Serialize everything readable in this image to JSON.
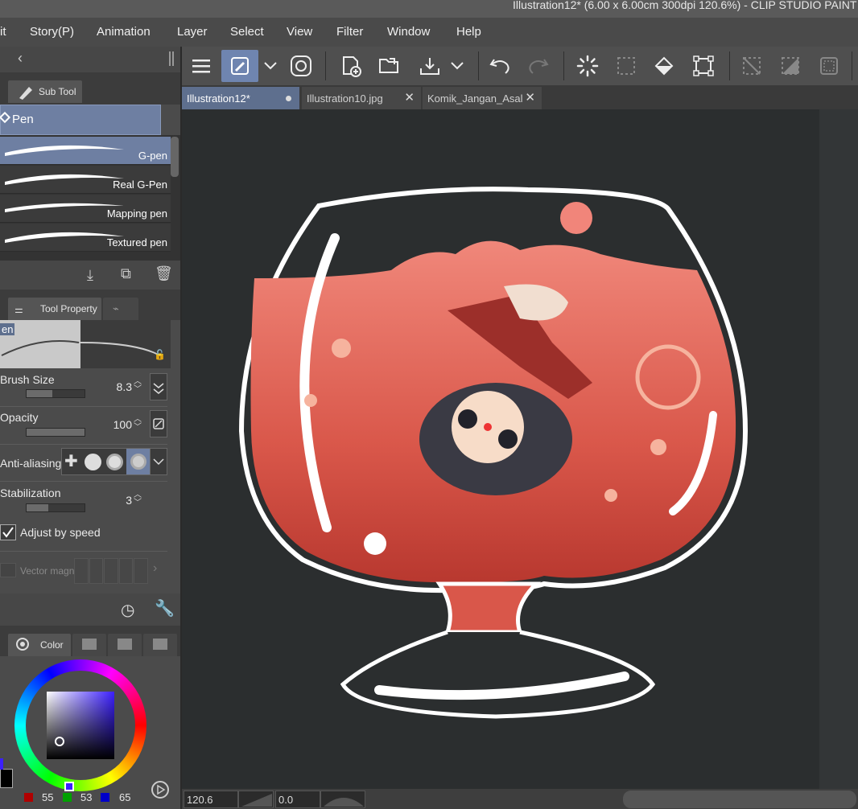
{
  "window": {
    "title": "Illustration12* (6.00 x 6.00cm 300dpi 120.6%)  - CLIP STUDIO PAINT"
  },
  "menu": {
    "items": [
      "it",
      "Story(P)",
      "Animation",
      "Layer",
      "Select",
      "View",
      "Filter",
      "Window",
      "Help"
    ]
  },
  "toolbar": {
    "icons": [
      "hamburger-menu-icon",
      "pen-tool-icon",
      "chevron-down-icon",
      "clip-studio-icon",
      "new-canvas-icon",
      "open-folder-icon",
      "export-icon",
      "chevron-down-icon",
      "undo-icon",
      "redo-icon",
      "loading-spinner-icon",
      "selection-icon",
      "fill-icon",
      "transform-icon",
      "deselect-icon",
      "invert-selection-icon",
      "frame-icon"
    ]
  },
  "tabs": [
    {
      "label": "Illustration12*",
      "active": true
    },
    {
      "label": "Illustration10.jpg",
      "active": false
    },
    {
      "label": "Komik_Jangan_Asal",
      "active": false
    }
  ],
  "subtool": {
    "tab_label": "Sub Tool",
    "group_label": "Pen",
    "brushes": [
      {
        "label": "G-pen",
        "selected": true
      },
      {
        "label": "Real G-Pen",
        "selected": false
      },
      {
        "label": "Mapping pen",
        "selected": false
      },
      {
        "label": "Textured pen",
        "selected": false
      }
    ]
  },
  "toolproperty": {
    "tab_label": "Tool Property",
    "preview_label": "en",
    "brush_size": {
      "label": "Brush Size",
      "value": "8.3",
      "fill": 0.45
    },
    "opacity": {
      "label": "Opacity",
      "value": "100",
      "fill": 1.0
    },
    "anti_aliasing": {
      "label": "Anti-aliasing",
      "selected_index": 3
    },
    "stabilization": {
      "label": "Stabilization",
      "value": "3",
      "fill": 0.38
    },
    "adjust_by_speed": {
      "label": "Adjust by speed",
      "checked": true
    },
    "vector_magnet": {
      "label": "Vector magne"
    }
  },
  "color": {
    "tab_label": "Color",
    "r": "55",
    "g": "53",
    "b": "65",
    "r_color": "#b00000",
    "g_color": "#00a000",
    "b_color": "#0000c8",
    "hue_color": "#3c20ff"
  },
  "status": {
    "zoom": "120.6",
    "rotation": "0.0"
  }
}
